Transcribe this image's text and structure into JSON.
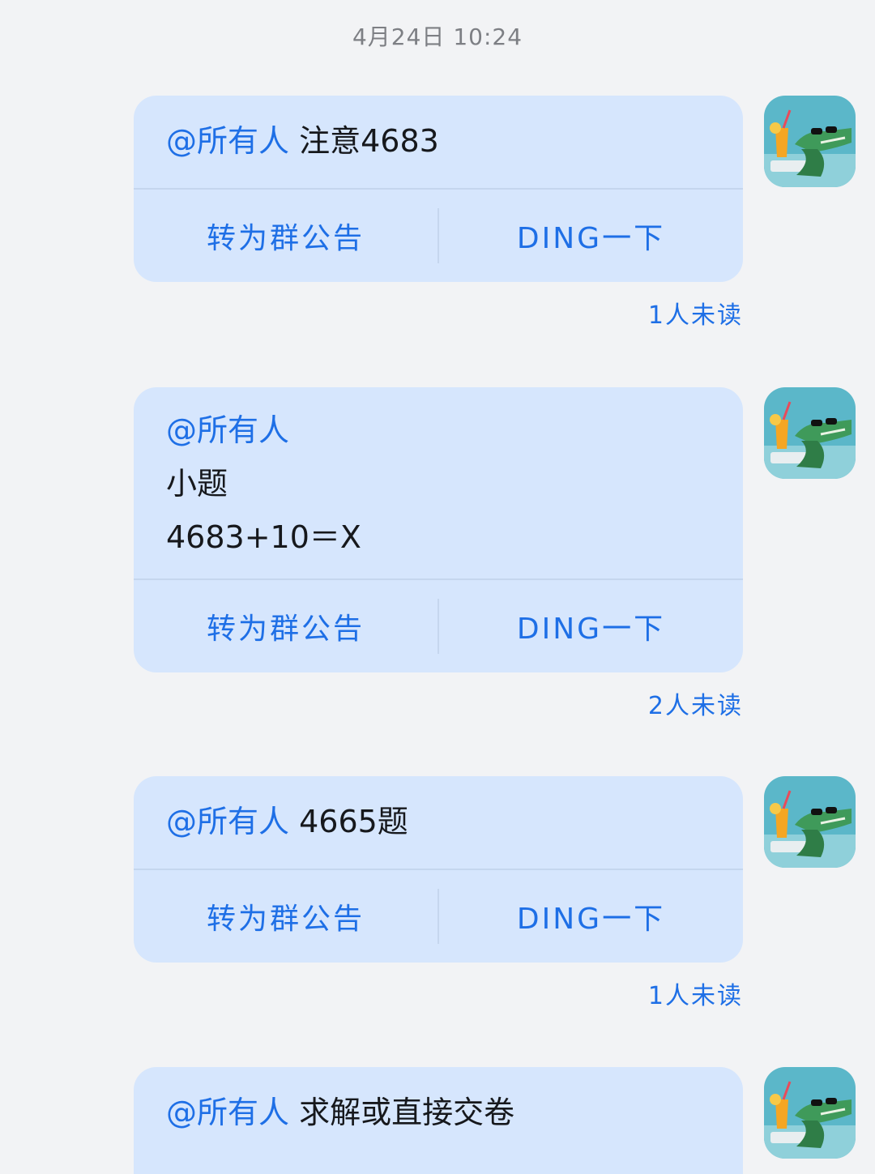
{
  "chat": {
    "timestamp": "4月24日 10:24",
    "messages": [
      {
        "mention": "@所有人",
        "lines_first": " 注意4683",
        "extra_lines": [],
        "action_announce": "转为群公告",
        "action_ding": "DING一下",
        "unread": "1人未读"
      },
      {
        "mention": "@所有人",
        "lines_first": "",
        "extra_lines": [
          "小题",
          "4683+10＝X"
        ],
        "action_announce": "转为群公告",
        "action_ding": "DING一下",
        "unread": "2人未读"
      },
      {
        "mention": "@所有人",
        "lines_first": " 4665题",
        "extra_lines": [],
        "action_announce": "转为群公告",
        "action_ding": "DING一下",
        "unread": "1人未读"
      },
      {
        "mention": "@所有人",
        "lines_first": " 求解或直接交卷",
        "extra_lines": [],
        "action_announce": "",
        "action_ding": "",
        "unread": ""
      }
    ]
  },
  "colors": {
    "background": "#f2f3f5",
    "bubble": "#d6e6fd",
    "accent": "#1e6fe6",
    "text": "#16181c",
    "timestamp": "#7d7f84"
  },
  "avatar": {
    "icon": "crocodile-sunglasses-avatar-icon"
  }
}
